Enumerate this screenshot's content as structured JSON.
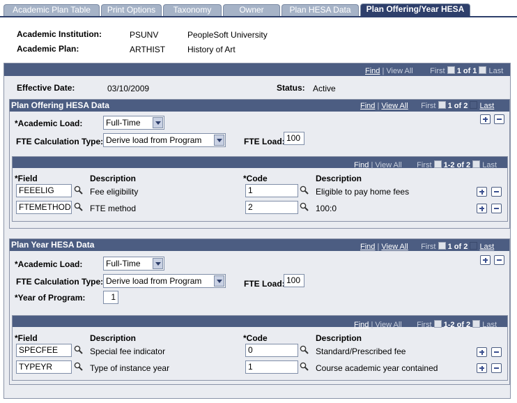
{
  "tabs": [
    {
      "label": "Academic Plan Table",
      "active": false
    },
    {
      "label": "Print Options",
      "active": false
    },
    {
      "label": "Taxonomy",
      "active": false
    },
    {
      "label": "Owner",
      "active": false
    },
    {
      "label": "Plan HESA Data",
      "active": false
    },
    {
      "label": "Plan Offering/Year HESA",
      "active": true
    }
  ],
  "header": {
    "institution_label": "Academic Institution:",
    "institution_code": "PSUNV",
    "institution_name": "PeopleSoft University",
    "plan_label": "Academic Plan:",
    "plan_code": "ARTHIST",
    "plan_name": "History of Art"
  },
  "nav": {
    "find": "Find",
    "sep": "|",
    "view_all": "View All",
    "first": "First",
    "last": "Last"
  },
  "effdt_panel": {
    "count": "1 of 1",
    "effdt_label": "Effective Date:",
    "effdt_value": "03/10/2009",
    "status_label": "Status:",
    "status_value": "Active"
  },
  "offering": {
    "title": "Plan Offering HESA Data",
    "count": "1 of 2",
    "academic_load_label": "*Academic Load:",
    "academic_load_value": "Full-Time",
    "fte_calc_label": "FTE Calculation Type:",
    "fte_calc_value": "Derive load from Program",
    "fte_load_label": "FTE Load:",
    "fte_load_value": "100",
    "grid_count": "1-2 of 2",
    "col_field": "*Field",
    "col_desc": "Description",
    "col_code": "*Code",
    "col_code_desc": "Description",
    "rows": [
      {
        "field": "FEEELIG",
        "desc": "Fee eligibility",
        "code": "1",
        "code_desc": "Eligible to pay home fees"
      },
      {
        "field": "FTEMETHOD",
        "desc": "FTE method",
        "code": "2",
        "code_desc": "100:0"
      }
    ]
  },
  "year": {
    "title": "Plan Year HESA Data",
    "count": "1 of 2",
    "academic_load_label": "*Academic Load:",
    "academic_load_value": "Full-Time",
    "fte_calc_label": "FTE Calculation Type:",
    "fte_calc_value": "Derive load from Program",
    "fte_load_label": "FTE Load:",
    "fte_load_value": "100",
    "year_label": "*Year of Program:",
    "year_value": "1",
    "grid_count": "1-2 of 2",
    "col_field": "*Field",
    "col_desc": "Description",
    "col_code": "*Code",
    "col_code_desc": "Description",
    "rows": [
      {
        "field": "SPECFEE",
        "desc": "Special fee indicator",
        "code": "0",
        "code_desc": "Standard/Prescribed fee"
      },
      {
        "field": "TYPEYR",
        "desc": "Type of instance year",
        "code": "1",
        "code_desc": "Course academic year contained"
      }
    ]
  }
}
